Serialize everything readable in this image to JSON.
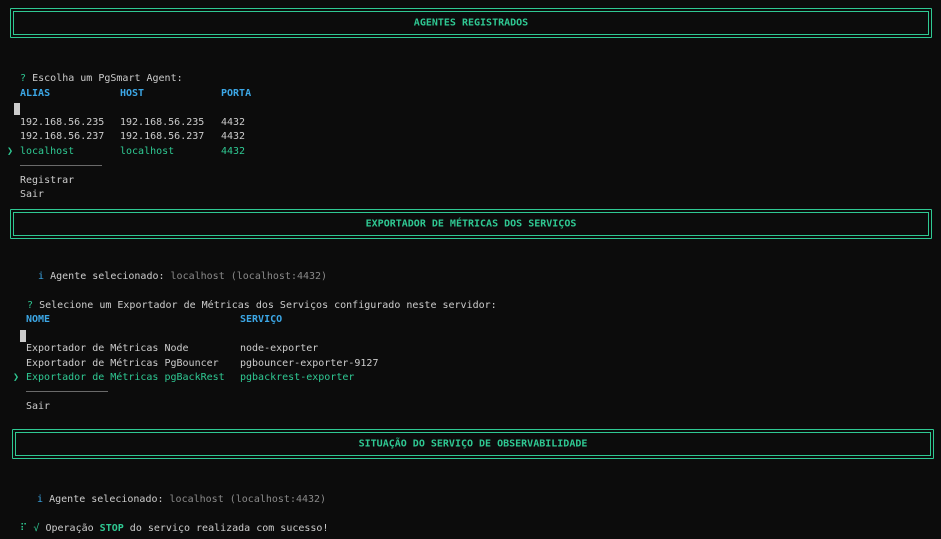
{
  "section1": {
    "banner": "AGENTES REGISTRADOS",
    "question_mark": "?",
    "prompt": "Escolha um PgSmart Agent:",
    "headers": {
      "alias": "ALIAS",
      "host": "HOST",
      "porta": "PORTA"
    },
    "rows": [
      {
        "alias": "192.168.56.235",
        "host": "192.168.56.235",
        "porta": "4432"
      },
      {
        "alias": "192.168.56.237",
        "host": "192.168.56.237",
        "porta": "4432"
      },
      {
        "alias": "localhost",
        "host": "localhost",
        "porta": "4432"
      }
    ],
    "pointer": "❯",
    "options": [
      "Registrar",
      "Sair"
    ]
  },
  "section2": {
    "banner": "EXPORTADOR DE MÉTRICAS DOS SERVIÇOS",
    "info_icon": "i",
    "info_label": "Agente selecionado:",
    "info_value": "localhost (localhost:4432)",
    "question_mark": "?",
    "prompt": "Selecione um Exportador de Métricas dos Serviços configurado neste servidor:",
    "headers": {
      "nome": "NOME",
      "servico": "SERVIÇO"
    },
    "rows": [
      {
        "nome": "Exportador de Métricas Node",
        "servico": "node-exporter"
      },
      {
        "nome": "Exportador de Métricas PgBouncer",
        "servico": "pgbouncer-exporter-9127"
      },
      {
        "nome": "Exportador de Métricas pgBackRest",
        "servico": "pgbackrest-exporter"
      }
    ],
    "pointer": "❯",
    "options": [
      "Sair"
    ]
  },
  "section3": {
    "banner": "SITUAÇÃO DO SERVIÇO DE OBSERVABILIDADE",
    "info_icon": "i",
    "info_label": "Agente selecionado:",
    "info_value": "localhost (localhost:4432)",
    "spinner": "⠏",
    "check": "√",
    "msg_before": "Operação",
    "msg_strong": "STOP",
    "msg_after": "do serviço realizada com sucesso!"
  },
  "colors": {
    "accent": "#2fc993",
    "header": "#3ca7e6",
    "text": "#cccccc",
    "dim": "#8a8a8a"
  }
}
